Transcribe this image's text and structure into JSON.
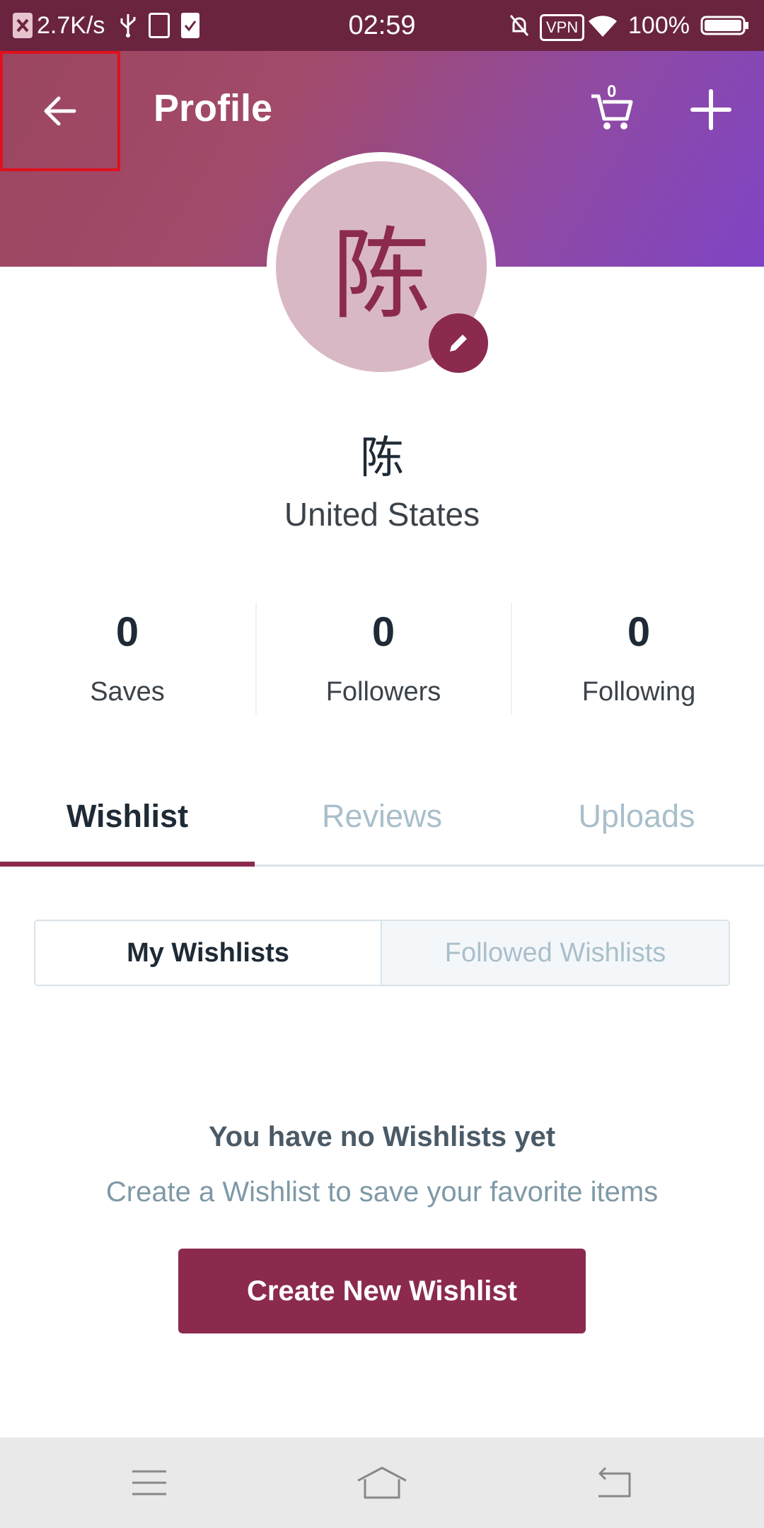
{
  "status_bar": {
    "speed": "2.7K/s",
    "time": "02:59",
    "vpn": "VPN",
    "battery": "100%"
  },
  "header": {
    "title": "Profile",
    "cart_count": "0"
  },
  "profile": {
    "avatar_initial": "陈",
    "name": "陈",
    "country": "United States"
  },
  "stats": [
    {
      "value": "0",
      "label": "Saves"
    },
    {
      "value": "0",
      "label": "Followers"
    },
    {
      "value": "0",
      "label": "Following"
    }
  ],
  "tabs": [
    {
      "label": "Wishlist"
    },
    {
      "label": "Reviews"
    },
    {
      "label": "Uploads"
    }
  ],
  "segments": {
    "my": "My Wishlists",
    "followed": "Followed Wishlists"
  },
  "empty": {
    "title": "You have no Wishlists yet",
    "subtitle": "Create a Wishlist to save your favorite items",
    "button": "Create New Wishlist"
  },
  "colors": {
    "brand": "#8b2a4e",
    "status_bar": "#6a2440",
    "inactive": "#a9bfcb"
  }
}
